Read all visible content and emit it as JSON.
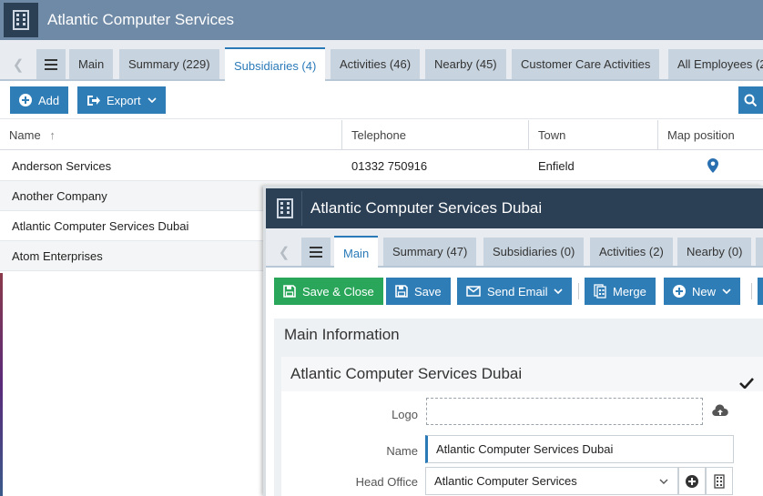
{
  "window_main": {
    "title": "Atlantic Computer Services",
    "tabs": [
      {
        "label": "Main"
      },
      {
        "label": "Summary (229)"
      },
      {
        "label": "Subsidiaries (4)"
      },
      {
        "label": "Activities (46)"
      },
      {
        "label": "Nearby (45)"
      },
      {
        "label": "Customer Care Activities"
      },
      {
        "label": "All Employees (2"
      }
    ],
    "active_tab": "Subsidiaries (4)",
    "toolbar": {
      "add_label": "Add",
      "export_label": "Export"
    },
    "grid": {
      "columns": {
        "name": "Name",
        "telephone": "Telephone",
        "town": "Town",
        "map": "Map position"
      },
      "rows": [
        {
          "name": "Anderson Services",
          "telephone": "01332 750916",
          "town": "Enfield",
          "has_map": true
        },
        {
          "name": "Another Company",
          "telephone": "",
          "town": "",
          "has_map": false
        },
        {
          "name": "Atlantic Computer Services Dubai",
          "telephone": "",
          "town": "",
          "has_map": false
        },
        {
          "name": "Atom Enterprises",
          "telephone": "",
          "town": "",
          "has_map": false
        }
      ]
    }
  },
  "window_detail": {
    "title": "Atlantic Computer Services Dubai",
    "tabs": [
      {
        "label": "Main"
      },
      {
        "label": "Summary (47)"
      },
      {
        "label": "Subsidiaries (0)"
      },
      {
        "label": "Activities (2)"
      },
      {
        "label": "Nearby (0)"
      }
    ],
    "active_tab": "Main",
    "toolbar": {
      "save_close_label": "Save & Close",
      "save_label": "Save",
      "send_email_label": "Send Email",
      "merge_label": "Merge",
      "new_label": "New"
    },
    "section_title": "Main Information",
    "subsection_title": "Atlantic Computer Services Dubai",
    "fields": {
      "logo_label": "Logo",
      "name_label": "Name",
      "name_value": "Atlantic Computer Services Dubai",
      "head_office_label": "Head Office",
      "head_office_value": "Atlantic Computer Services"
    }
  },
  "colors": {
    "accent": "#2f7db6",
    "green": "#2aa65a",
    "title_dark": "#2b3f55",
    "title_light": "#6f8aa6"
  }
}
